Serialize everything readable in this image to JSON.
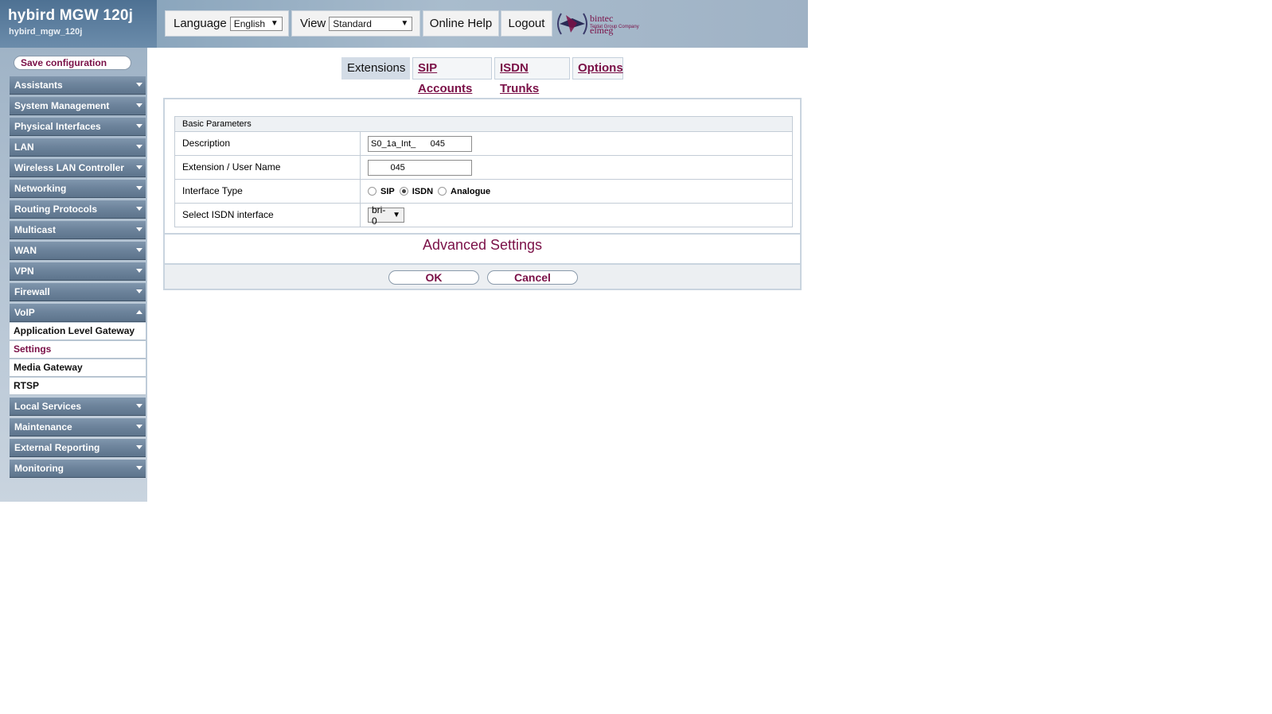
{
  "header": {
    "device_name": "hybird MGW 120j",
    "device_host": "hybird_mgw_120j",
    "language_label": "Language",
    "language_value": "English",
    "view_label": "View",
    "view_value": "Standard",
    "online_help": "Online Help",
    "logout": "Logout",
    "logo_brand": "bintec elmeg",
    "logo_sub": "Teldat Group Company"
  },
  "sidebar": {
    "save_configuration": "Save configuration",
    "menu": [
      {
        "label": "Assistants"
      },
      {
        "label": "System Management"
      },
      {
        "label": "Physical Interfaces"
      },
      {
        "label": "LAN"
      },
      {
        "label": "Wireless LAN Controller"
      },
      {
        "label": "Networking"
      },
      {
        "label": "Routing Protocols"
      },
      {
        "label": "Multicast"
      },
      {
        "label": "WAN"
      },
      {
        "label": "VPN"
      },
      {
        "label": "Firewall"
      },
      {
        "label": "VoIP"
      }
    ],
    "voip_sub": [
      {
        "label": "Application Level Gateway"
      },
      {
        "label": "Settings"
      },
      {
        "label": "Media Gateway"
      },
      {
        "label": "RTSP"
      }
    ],
    "menu_bottom": [
      {
        "label": "Local Services"
      },
      {
        "label": "Maintenance"
      },
      {
        "label": "External Reporting"
      },
      {
        "label": "Monitoring"
      }
    ]
  },
  "tabs": [
    {
      "label": "Extensions"
    },
    {
      "label": "SIP Accounts"
    },
    {
      "label": "ISDN Trunks"
    },
    {
      "label": "Options"
    }
  ],
  "form": {
    "section_title": "Basic Parameters",
    "description_label": "Description",
    "description_value": "S0_1a_Int_      045",
    "extension_label": "Extension / User Name",
    "extension_value": "        045",
    "interface_type_label": "Interface Type",
    "radio_sip": "SIP",
    "radio_isdn": "ISDN",
    "radio_analogue": "Analogue",
    "isdn_interface_label": "Select ISDN interface",
    "isdn_interface_value": "bri-0",
    "advanced_settings": "Advanced Settings",
    "ok": "OK",
    "cancel": "Cancel"
  },
  "colors": {
    "accent": "#7a1047",
    "menu_bg": "#6d849c"
  }
}
